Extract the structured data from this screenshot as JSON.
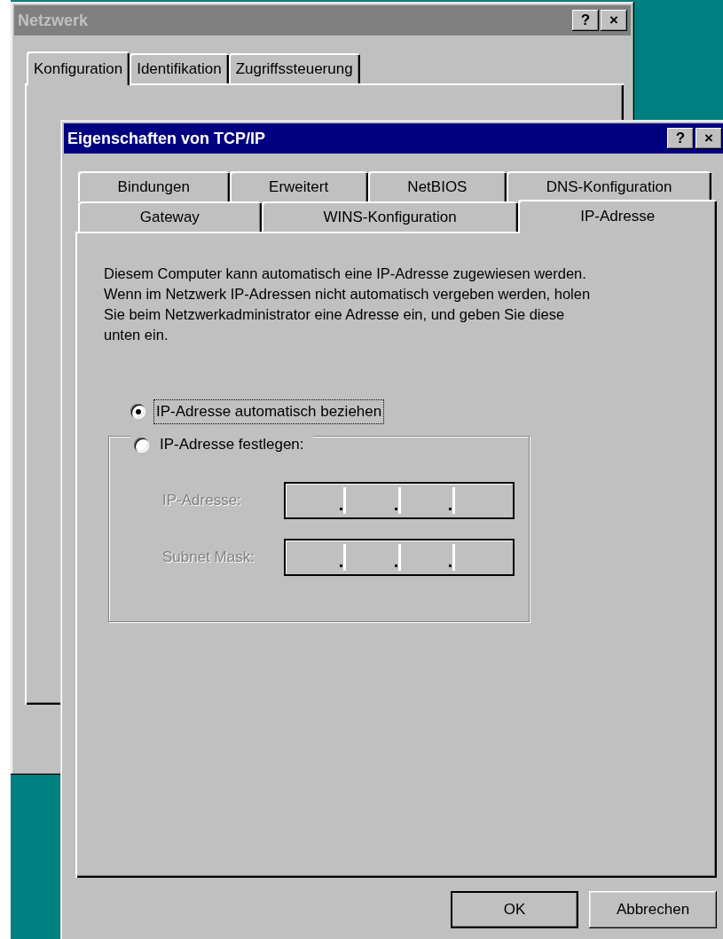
{
  "back_window": {
    "title": "Netzwerk",
    "active": false,
    "title_buttons": [
      "?",
      "×"
    ],
    "tabs": [
      {
        "label": "Konfiguration",
        "selected": true
      },
      {
        "label": "Identifikation",
        "selected": false
      },
      {
        "label": "Zugriffssteuerung",
        "selected": false
      }
    ]
  },
  "dialog": {
    "title": "Eigenschaften von TCP/IP",
    "active": true,
    "title_buttons": [
      "?",
      "×"
    ],
    "tab_rows": [
      [
        {
          "label": "Bindungen",
          "selected": false
        },
        {
          "label": "Erweitert",
          "selected": false
        },
        {
          "label": "NetBIOS",
          "selected": false
        },
        {
          "label": "DNS-Konfiguration",
          "selected": false
        }
      ],
      [
        {
          "label": "Gateway",
          "selected": false
        },
        {
          "label": "WINS-Konfiguration",
          "selected": false
        },
        {
          "label": "IP-Adresse",
          "selected": true
        }
      ]
    ],
    "description": "Diesem Computer kann automatisch eine IP-Adresse zugewiesen werden. Wenn im Netzwerk IP-Adressen nicht automatisch vergeben werden, holen Sie beim Netzwerkadministrator eine Adresse ein, und geben Sie diese unten ein.",
    "options": [
      {
        "label": "IP-Adresse automatisch beziehen",
        "selected": true,
        "focused": true
      },
      {
        "label": "IP-Adresse festlegen:",
        "selected": false,
        "focused": false
      }
    ],
    "fields": [
      {
        "label": "IP-Adresse:",
        "disabled": true
      },
      {
        "label": "Subnet Mask:",
        "disabled": true
      }
    ],
    "buttons": [
      {
        "label": "OK",
        "default": true
      },
      {
        "label": "Abbrechen",
        "default": false
      }
    ]
  }
}
